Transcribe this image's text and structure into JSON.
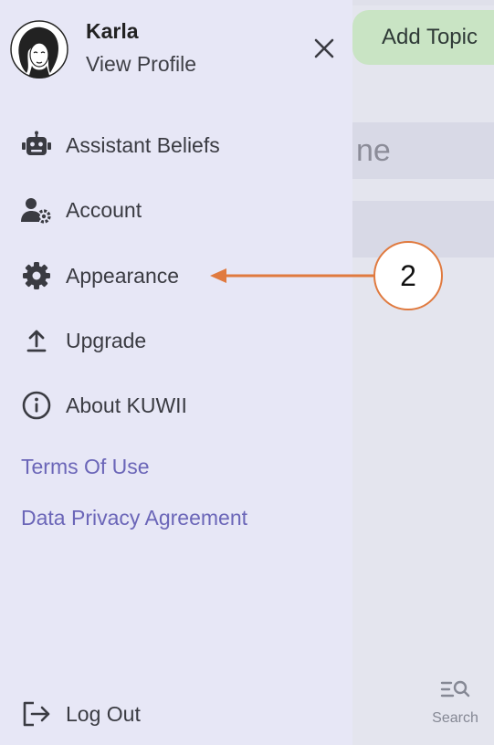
{
  "background": {
    "add_topic_label": "Add Topic",
    "row_partial_text": "ne",
    "search_label": "Search",
    "search_icon": "list-search-icon"
  },
  "profile": {
    "name": "Karla",
    "view_profile_label": "View Profile",
    "avatar_icon": "avatar-illustration"
  },
  "menu": {
    "items": [
      {
        "label": "Assistant Beliefs",
        "icon": "robot-icon"
      },
      {
        "label": "Account",
        "icon": "user-gear-icon"
      },
      {
        "label": "Appearance",
        "icon": "gear-icon"
      },
      {
        "label": "Upgrade",
        "icon": "upload-icon"
      },
      {
        "label": "About KUWII",
        "icon": "info-icon"
      }
    ]
  },
  "links": {
    "terms": "Terms Of Use",
    "privacy": "Data Privacy Agreement"
  },
  "logout_label": "Log Out",
  "annotation": {
    "number": "2",
    "color": "#e07a3f"
  },
  "colors": {
    "drawer_bg": "#e7e7f6",
    "link": "#6b66b8",
    "add_topic_bg": "#c9e4c4"
  }
}
